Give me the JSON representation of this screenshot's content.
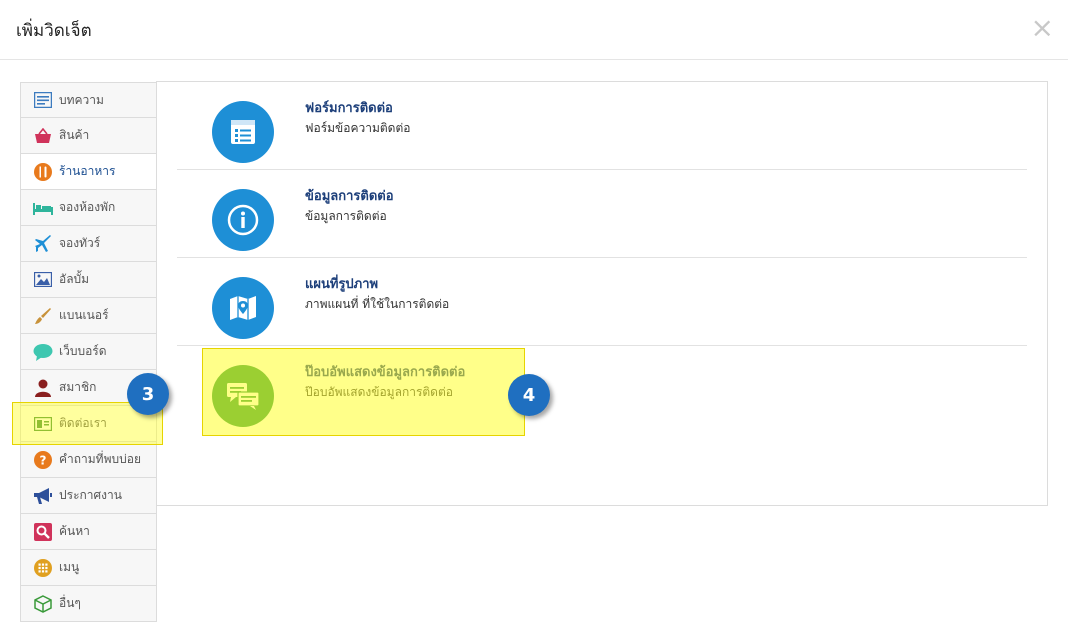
{
  "dialog": {
    "title": "เพิ่มวิดเจ็ต",
    "close_glyph": "×"
  },
  "sidebar": {
    "items": [
      {
        "label": "บทความ",
        "icon": "article-icon",
        "color": "#3c7bbf"
      },
      {
        "label": "สินค้า",
        "icon": "shopping-basket-icon",
        "color": "#d0335b"
      },
      {
        "label": "ร้านอาหาร",
        "icon": "restaurant-icon",
        "color": "#e87a1d",
        "active": true
      },
      {
        "label": "จองห้องพัก",
        "icon": "bed-icon",
        "color": "#2fb59c"
      },
      {
        "label": "จองทัวร์",
        "icon": "airplane-icon",
        "color": "#1e8fd6"
      },
      {
        "label": "อัลบั้ม",
        "icon": "photo-album-icon",
        "color": "#3a5fa8"
      },
      {
        "label": "แบนเนอร์",
        "icon": "paintbrush-icon",
        "color": "#c8923a"
      },
      {
        "label": "เว็บบอร์ด",
        "icon": "chat-bubble-icon",
        "color": "#3ec7b0"
      },
      {
        "label": "สมาชิก",
        "icon": "user-icon",
        "color": "#8a1f1f"
      },
      {
        "label": "ติดต่อเรา",
        "icon": "contact-card-icon",
        "color": "#3a8a3a",
        "highlight": true
      },
      {
        "label": "คำถามที่พบบ่อย",
        "icon": "question-icon",
        "color": "#e87a1d"
      },
      {
        "label": "ประกาศงาน",
        "icon": "megaphone-icon",
        "color": "#2d4f9a"
      },
      {
        "label": "ค้นหา",
        "icon": "search-icon",
        "color": "#d0335b"
      },
      {
        "label": "เมนู",
        "icon": "menu-grid-icon",
        "color": "#e0a020"
      },
      {
        "label": "อื่นๆ",
        "icon": "box-icon",
        "color": "#3a9a3a"
      }
    ]
  },
  "widgets": [
    {
      "title": "ฟอร์มการติดต่อ",
      "desc": "ฟอร์มข้อความติดต่อ",
      "icon": "form-icon",
      "color": "#1e8fd6"
    },
    {
      "title": "ข้อมูลการติดต่อ",
      "desc": "ข้อมูลการติดต่อ",
      "icon": "info-icon",
      "color": "#1e8fd6"
    },
    {
      "title": "แผนที่รูปภาพ",
      "desc": "ภาพแผนที่ ที่ใช้ในการติดต่อ",
      "icon": "map-icon",
      "color": "#1e8fd6"
    },
    {
      "title": "ป๊อบอัพแสดงข้อมูลการติดต่อ",
      "desc": "ป๊อบอัพแสดงข้อมูลการติดต่อ",
      "icon": "chat-popup-icon",
      "color": "#22963f"
    }
  ],
  "callouts": {
    "step3": "3",
    "step4": "4",
    "badge_color": "#1f6fc0",
    "highlight_color": "#ffff28"
  }
}
